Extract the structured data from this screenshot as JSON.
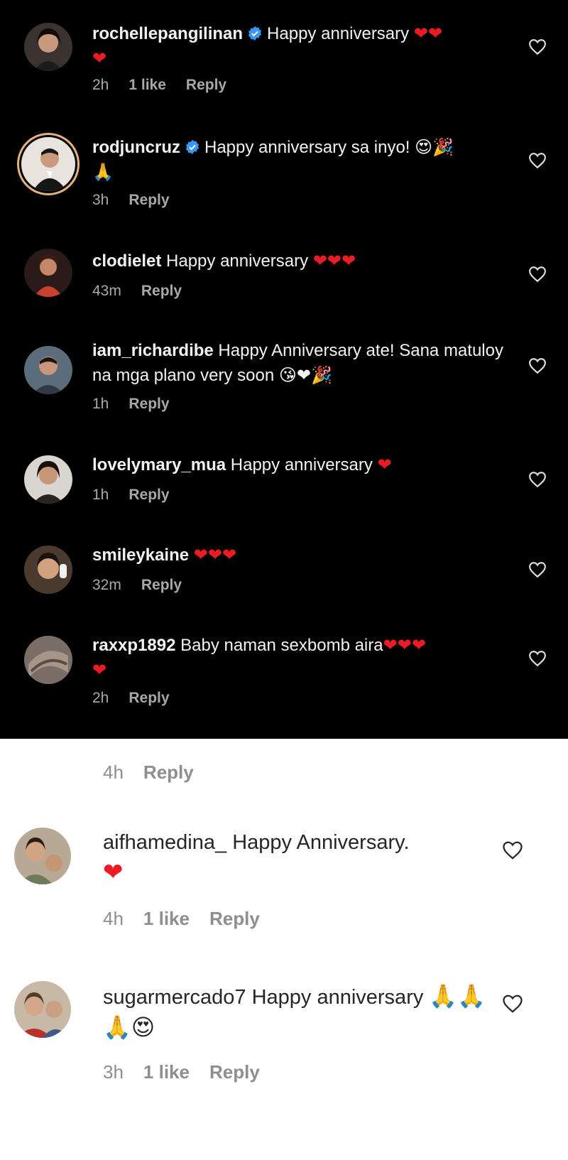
{
  "dark_comments": [
    {
      "username": "rochellepangilinan",
      "verified": true,
      "text": "Happy anniversary",
      "emoji": "❤❤\n❤",
      "time": "2h",
      "likes": "1 like",
      "reply": "Reply"
    },
    {
      "username": "rodjuncruz",
      "verified": true,
      "text": "Happy anniversary sa inyo!",
      "emoji": "😍🎉\n🙏",
      "time": "3h",
      "likes": "",
      "reply": "Reply"
    },
    {
      "username": "clodielet",
      "verified": false,
      "text": "Happy anniversary",
      "emoji": "❤❤❤",
      "time": "43m",
      "likes": "",
      "reply": "Reply"
    },
    {
      "username": "iam_richardibe",
      "verified": false,
      "text": "Happy Anniversary ate! Sana matuloy na mga plano very soon",
      "emoji": "😘❤🎉",
      "time": "1h",
      "likes": "",
      "reply": "Reply"
    },
    {
      "username": "lovelymary_mua",
      "verified": false,
      "text": "Happy anniversary",
      "emoji": "❤",
      "time": "1h",
      "likes": "",
      "reply": "Reply"
    },
    {
      "username": "smileykaine",
      "verified": false,
      "text": "",
      "emoji": "❤❤❤",
      "time": "32m",
      "likes": "",
      "reply": "Reply"
    },
    {
      "username": "raxxp1892",
      "verified": false,
      "text": "Baby naman  sexbomb aira",
      "emoji": "❤❤❤\n❤",
      "time": "2h",
      "likes": "",
      "reply": "Reply"
    }
  ],
  "light_top_meta": {
    "time": "4h",
    "reply": "Reply"
  },
  "light_comments": [
    {
      "username": "aifhamedina_",
      "text": "Happy Anniversary.",
      "emoji": "❤",
      "time": "4h",
      "likes": "1 like",
      "reply": "Reply"
    },
    {
      "username": "sugarmercado7",
      "text": "Happy anniversary",
      "emoji": "🙏🙏🙏😍",
      "time": "3h",
      "likes": "1 like",
      "reply": "Reply"
    }
  ],
  "colors": {
    "dark_bg": "#000000",
    "light_bg": "#ffffff",
    "verified": "#3897f0",
    "heart": "#ed1c24",
    "story_ring": "#e7b27a"
  }
}
